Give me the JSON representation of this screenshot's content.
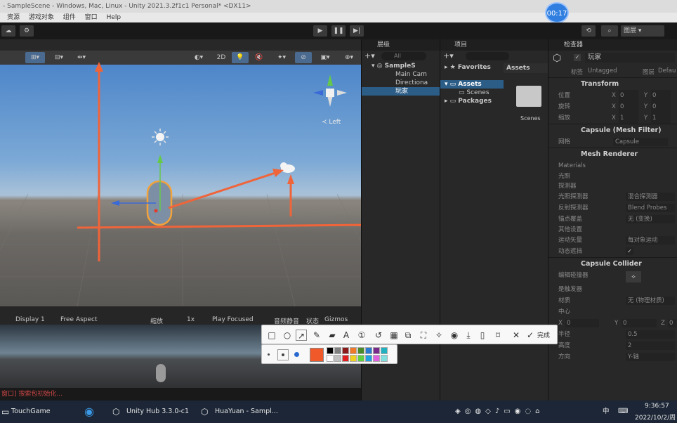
{
  "window": {
    "title": "- SampleScene - Windows, Mac, Linux - Unity 2021.3.2f1c1 Personal* <DX11>"
  },
  "menu": [
    "资源",
    "游戏对象",
    "组件",
    "窗口",
    "Help"
  ],
  "timer": "00:17",
  "toolbar": {
    "layers_label": "图层"
  },
  "scene": {
    "mode_2d": "2D",
    "left_label": "≺ Left"
  },
  "game": {
    "display": "Display 1",
    "aspect": "Free Aspect",
    "scale_label": "缩放",
    "scale_value": "1x",
    "play_mode": "Play Focused",
    "mute": "音频静音",
    "stats": "状态",
    "gizmos": "Gizmos"
  },
  "status_message": "窗口] 搜索包初始化...",
  "hierarchy": {
    "tab": "层级",
    "search_placeholder": "All",
    "scene": "SampleS",
    "items": [
      "Main Cam",
      "Directiona",
      "玩家"
    ]
  },
  "project": {
    "tab": "项目",
    "favorites": "Favorites",
    "assets": "Assets",
    "scenes": "Scenes",
    "packages": "Packages",
    "breadcrumb": "Assets",
    "folder": "Scenes"
  },
  "inspector": {
    "tab": "检查器",
    "object_name": "玩家",
    "tag_label": "标签",
    "tag_value": "Untagged",
    "layer_label": "图层",
    "layer_value": "Defau",
    "transform": "Transform",
    "position_label": "位置",
    "rotation_label": "旋转",
    "scale_label": "缩放",
    "position": [
      "0",
      "0"
    ],
    "rotation": [
      "0",
      "0"
    ],
    "scale": [
      "1",
      "1"
    ],
    "mesh_filter": "Capsule (Mesh Filter)",
    "mesh_label": "网格",
    "mesh_value": "Capsule",
    "mesh_renderer": "Mesh Renderer",
    "materials": "Materials",
    "lighting": "光照",
    "probes": "探测器",
    "light_probes_label": "光照探测器",
    "light_probes_value": "混合探测器",
    "reflection_label": "反射探测器",
    "reflection_value": "Blend Probes",
    "anchor_label": "锚点覆盖",
    "anchor_value": "无 (变换)",
    "other": "其他设置",
    "motion_label": "运动矢量",
    "motion_value": "每对象运动",
    "dynamic_label": "动态遮挡",
    "capsule_collider": "Capsule Collider",
    "edit_collider": "编辑碰撞器",
    "is_trigger": "是触发器",
    "material_label": "材质",
    "material_value": "无 (物理材质)",
    "center_label": "中心",
    "center": [
      "0",
      "0",
      "0"
    ],
    "radius_label": "半径",
    "radius_value": "0.5",
    "height_label": "高度",
    "height_value": "2",
    "direction_label": "方向",
    "direction_value": "Y-轴"
  },
  "annotation": {
    "done_label": "完成"
  },
  "palette": [
    "#000000",
    "#808080",
    "#8b1a1a",
    "#f07a2b",
    "#4a8a2a",
    "#2a7ad0",
    "#7a2a8a",
    "#20b0c0",
    "#ffffff",
    "#c0c0c0",
    "#e02020",
    "#f0d020",
    "#60d040",
    "#20a0e0",
    "#e060e0",
    "#80e0e0"
  ],
  "active_color": "#f05a2a",
  "taskbar": {
    "items": [
      "TouchGame",
      "Unity Hub 3.3.0-c1",
      "HuaYuan - Sampl..."
    ],
    "time": "9:36:57",
    "date": "2022/10/2/周",
    "ime": "中"
  }
}
